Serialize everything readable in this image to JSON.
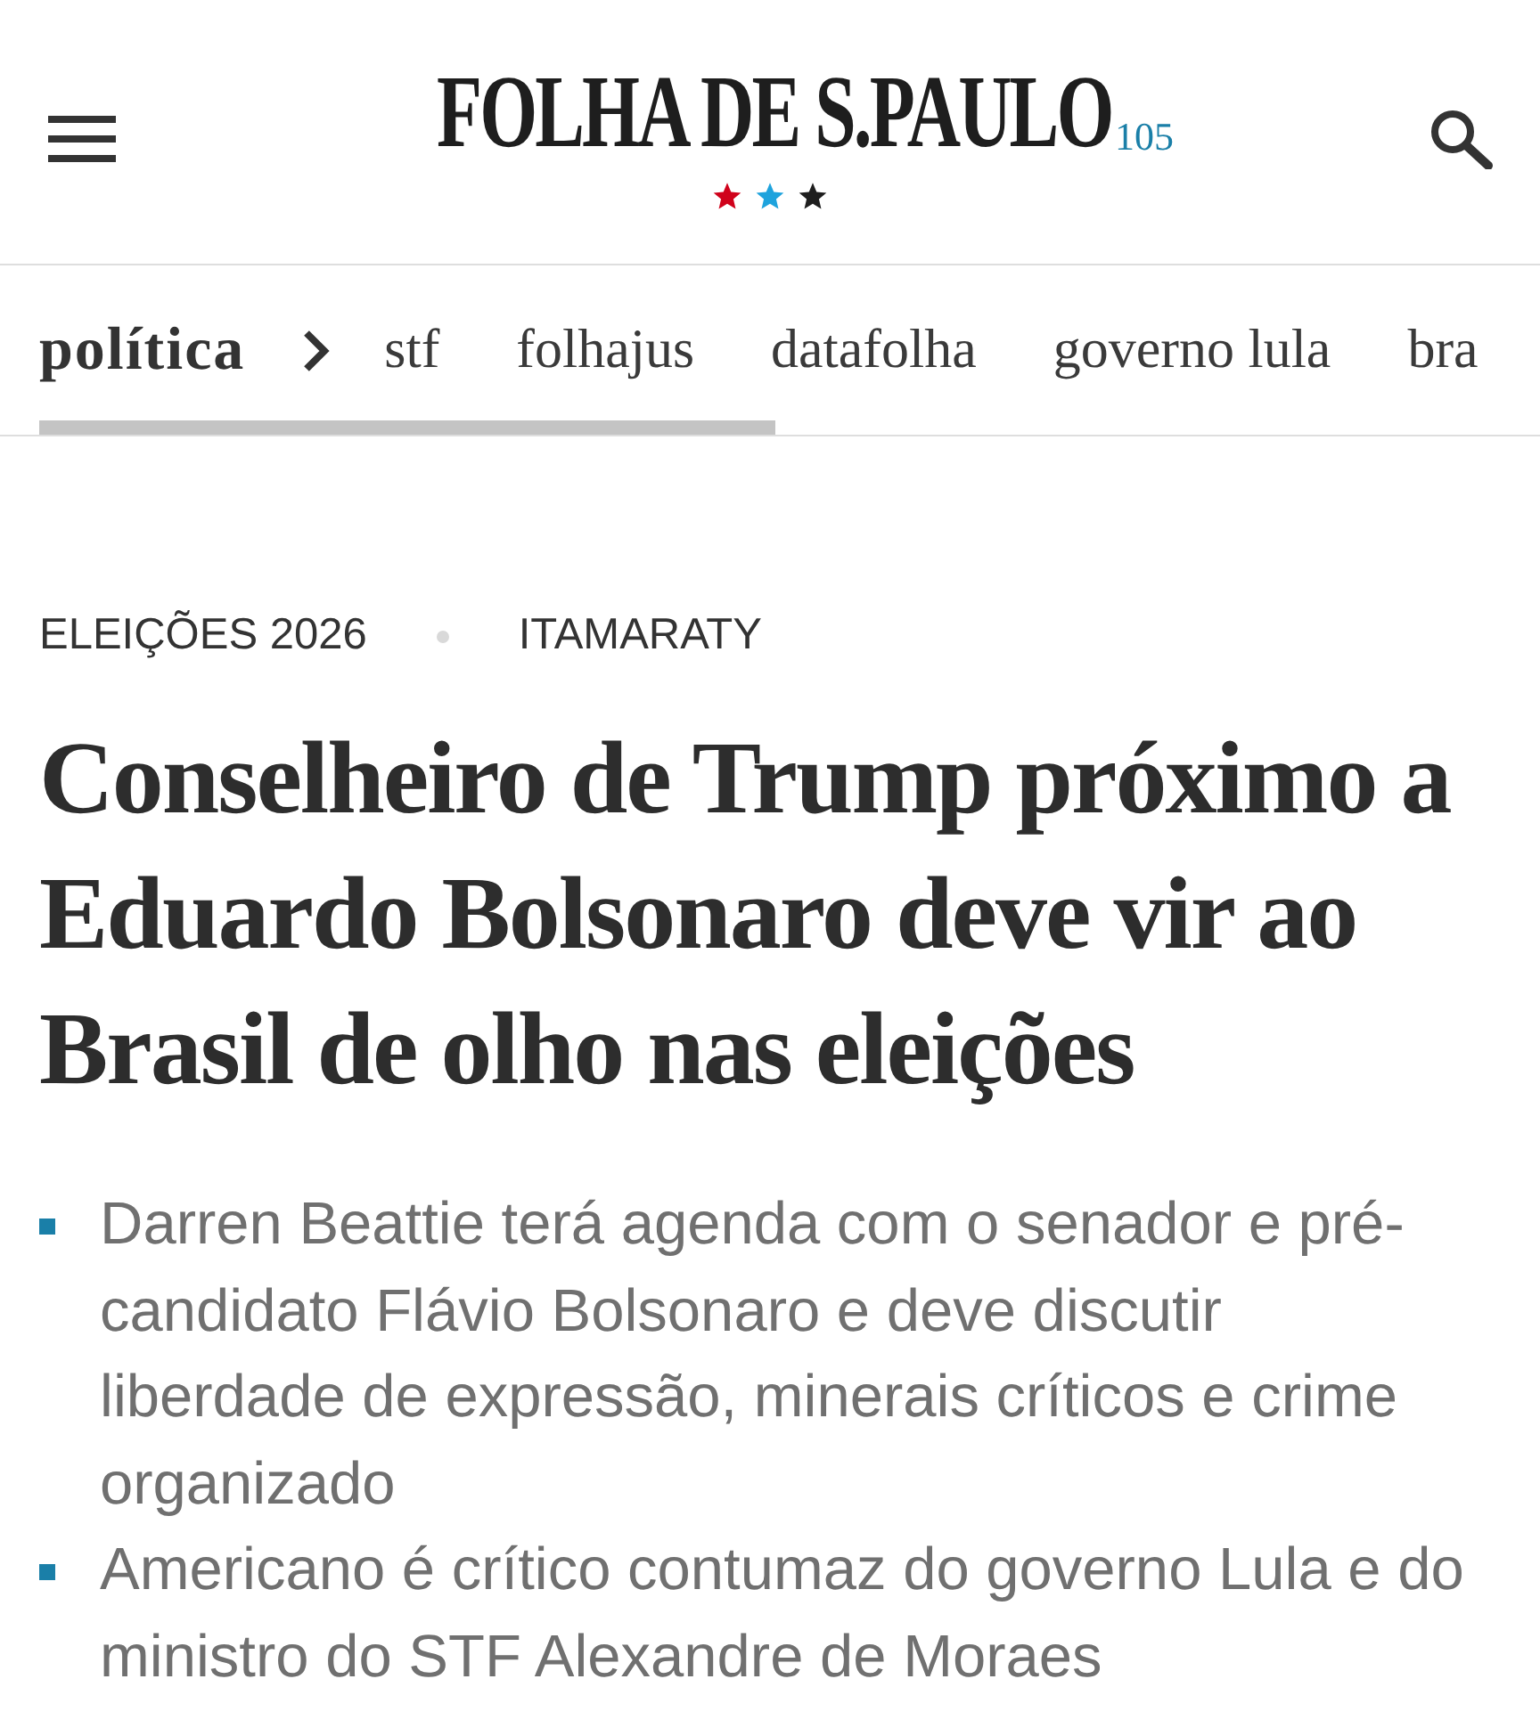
{
  "header": {
    "logo": "FOLHA DE S.PAULO",
    "logo_badge": "105"
  },
  "section_nav": {
    "section": "política",
    "links": [
      "stf",
      "folhajus",
      "datafolha",
      "governo lula",
      "bra"
    ]
  },
  "tags": [
    "ELEIÇÕES 2026",
    "ITAMARATY"
  ],
  "headline": "Conselheiro de Trump próximo a Eduardo Bolsonaro deve vir ao Brasil de olho nas eleições",
  "summary": [
    "Darren Beattie terá agenda com o senador e pré-candidato Flávio Bolsonaro e deve discutir liberdade de expressão, minerais críticos e crime organizado",
    "Americano é crítico contumaz do governo Lula e do ministro do STF Alexandre de Moraes"
  ]
}
